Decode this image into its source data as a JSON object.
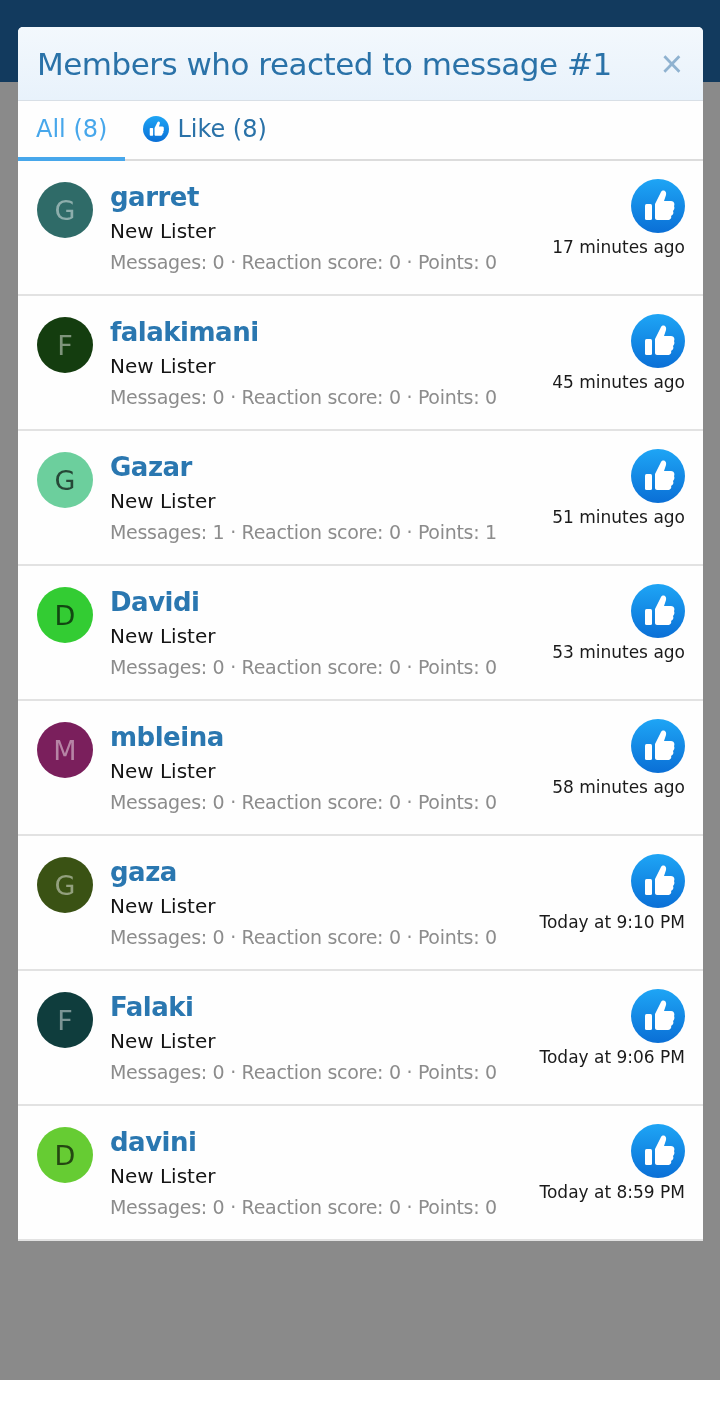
{
  "dialog": {
    "title": "Members who reacted to message #1",
    "close": "×"
  },
  "tabs": [
    {
      "label": "All (8)",
      "selected": true,
      "kind": "all"
    },
    {
      "label": "Like (8)",
      "selected": false,
      "kind": "like"
    }
  ],
  "members": [
    {
      "initial": "G",
      "color": "#2f6b68",
      "name": "garret",
      "title": "New Lister",
      "stats": "Messages: 0 · Reaction score: 0 · Points: 0",
      "time": "17 minutes ago"
    },
    {
      "initial": "F",
      "color": "#143d0f",
      "name": "falakimani",
      "title": "New Lister",
      "stats": "Messages: 0 · Reaction score: 0 · Points: 0",
      "time": "45 minutes ago"
    },
    {
      "initial": "G",
      "color": "#6ccf9d",
      "name": "Gazar",
      "title": "New Lister",
      "stats": "Messages: 1 · Reaction score: 0 · Points: 1",
      "time": "51 minutes ago"
    },
    {
      "initial": "D",
      "color": "#33cc33",
      "name": "Davidi",
      "title": "New Lister",
      "stats": "Messages: 0 · Reaction score: 0 · Points: 0",
      "time": "53 minutes ago"
    },
    {
      "initial": "M",
      "color": "#7a1f5c",
      "name": "mbleina",
      "title": "New Lister",
      "stats": "Messages: 0 · Reaction score: 0 · Points: 0",
      "time": "58 minutes ago"
    },
    {
      "initial": "G",
      "color": "#3a5214",
      "name": "gaza",
      "title": "New Lister",
      "stats": "Messages: 0 · Reaction score: 0 · Points: 0",
      "time": "Today at 9:10 PM"
    },
    {
      "initial": "F",
      "color": "#0f3d3d",
      "name": "Falaki",
      "title": "New Lister",
      "stats": "Messages: 0 · Reaction score: 0 · Points: 0",
      "time": "Today at 9:06 PM"
    },
    {
      "initial": "D",
      "color": "#66cc33",
      "name": "davini",
      "title": "New Lister",
      "stats": "Messages: 0 · Reaction score: 0 · Points: 0",
      "time": "Today at 8:59 PM"
    }
  ]
}
